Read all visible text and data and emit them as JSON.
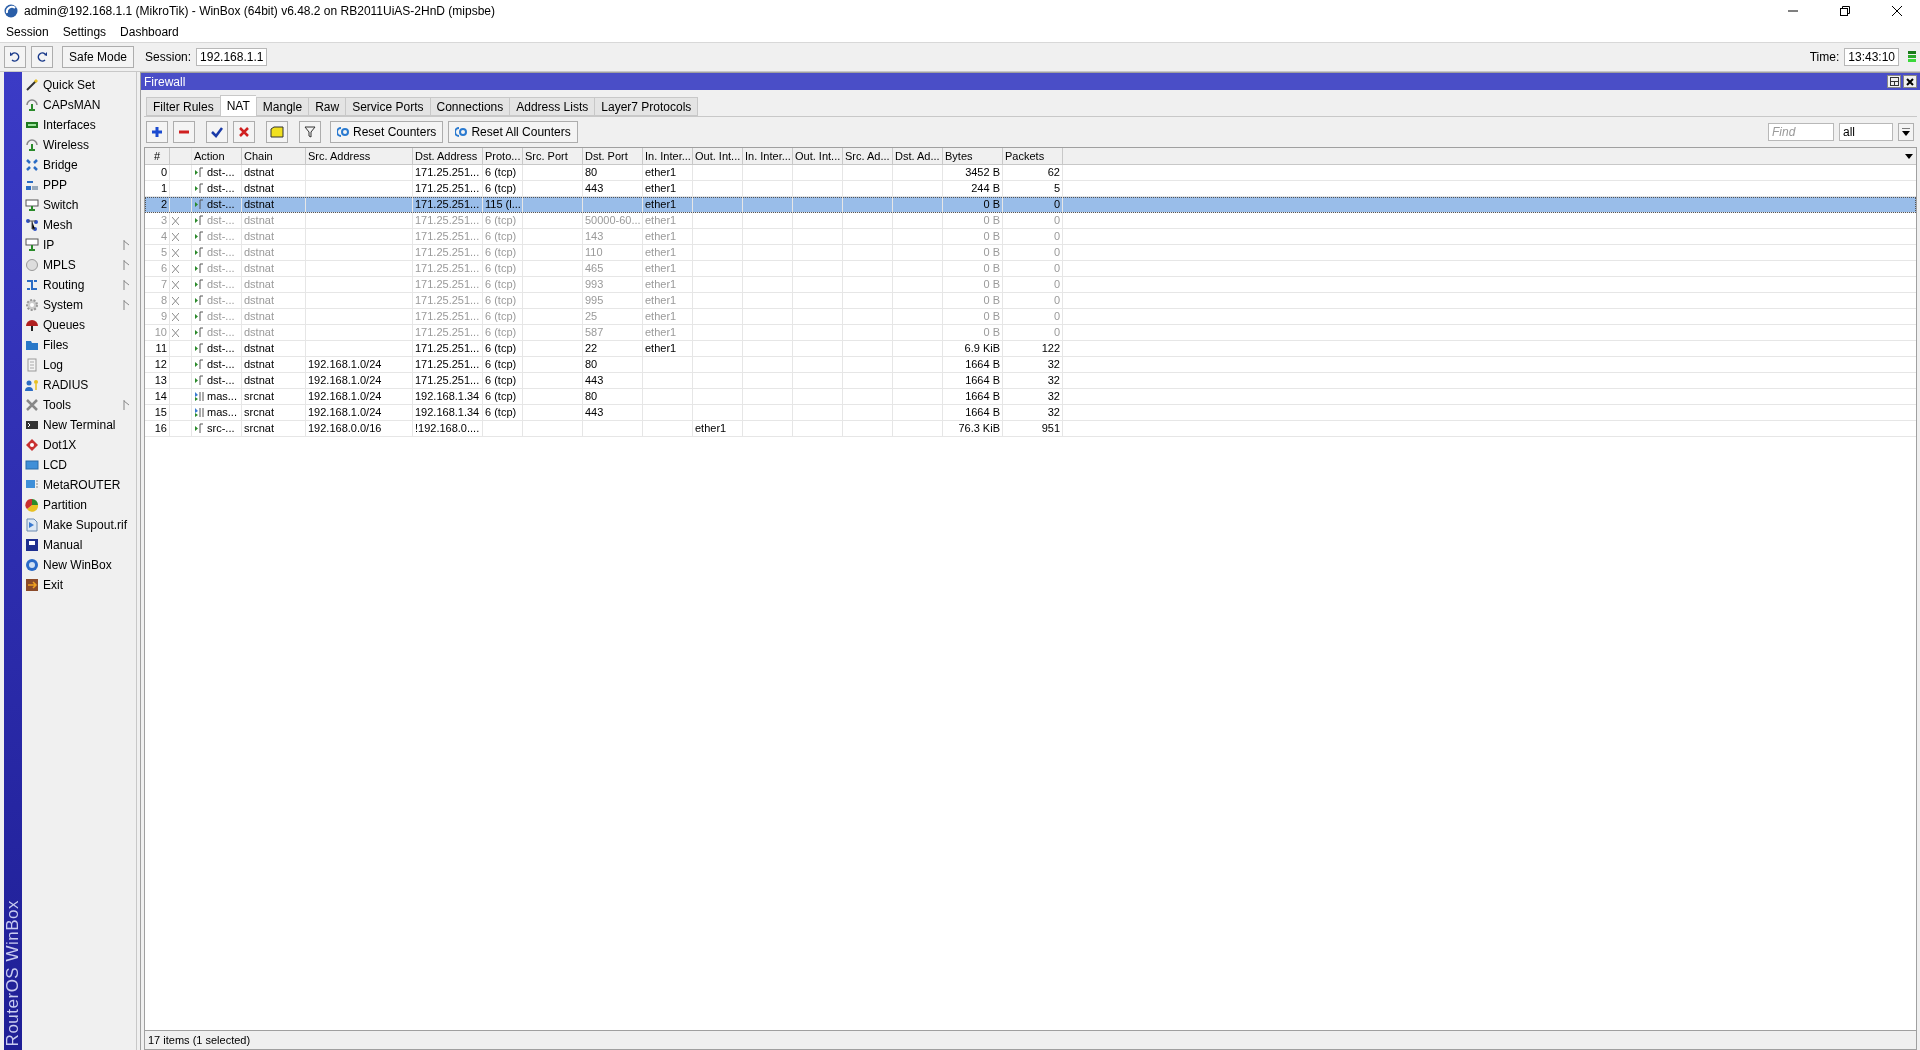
{
  "window": {
    "title": "admin@192.168.1.1 (MikroTik) - WinBox (64bit) v6.48.2 on RB2011UiAS-2HnD (mipsbe)"
  },
  "menu": [
    "Session",
    "Settings",
    "Dashboard"
  ],
  "toolbar": {
    "safe_mode": "Safe Mode",
    "session_label": "Session:",
    "session_value": "192.168.1.1",
    "time_label": "Time:",
    "time_value": "13:43:10"
  },
  "brand": "RouterOS WinBox",
  "sidebar": {
    "items": [
      {
        "label": "Quick Set",
        "submenu": false
      },
      {
        "label": "CAPsMAN",
        "submenu": false
      },
      {
        "label": "Interfaces",
        "submenu": false
      },
      {
        "label": "Wireless",
        "submenu": false
      },
      {
        "label": "Bridge",
        "submenu": false
      },
      {
        "label": "PPP",
        "submenu": false
      },
      {
        "label": "Switch",
        "submenu": false
      },
      {
        "label": "Mesh",
        "submenu": false
      },
      {
        "label": "IP",
        "submenu": true
      },
      {
        "label": "MPLS",
        "submenu": true
      },
      {
        "label": "Routing",
        "submenu": true
      },
      {
        "label": "System",
        "submenu": true
      },
      {
        "label": "Queues",
        "submenu": false
      },
      {
        "label": "Files",
        "submenu": false
      },
      {
        "label": "Log",
        "submenu": false
      },
      {
        "label": "RADIUS",
        "submenu": false
      },
      {
        "label": "Tools",
        "submenu": true
      },
      {
        "label": "New Terminal",
        "submenu": false
      },
      {
        "label": "Dot1X",
        "submenu": false
      },
      {
        "label": "LCD",
        "submenu": false
      },
      {
        "label": "MetaROUTER",
        "submenu": false
      },
      {
        "label": "Partition",
        "submenu": false
      },
      {
        "label": "Make Supout.rif",
        "submenu": false
      },
      {
        "label": "Manual",
        "submenu": false
      },
      {
        "label": "New WinBox",
        "submenu": false
      },
      {
        "label": "Exit",
        "submenu": false
      }
    ]
  },
  "firewall": {
    "title": "Firewall",
    "tabs": [
      {
        "label": "Filter Rules",
        "selected": false
      },
      {
        "label": "NAT",
        "selected": true
      },
      {
        "label": "Mangle",
        "selected": false
      },
      {
        "label": "Raw",
        "selected": false
      },
      {
        "label": "Service Ports",
        "selected": false
      },
      {
        "label": "Connections",
        "selected": false
      },
      {
        "label": "Address Lists",
        "selected": false
      },
      {
        "label": "Layer7 Protocols",
        "selected": false
      }
    ],
    "buttons": {
      "reset_counters": "Reset Counters",
      "reset_all_counters": "Reset All Counters"
    },
    "find": {
      "placeholder": "Find"
    },
    "filter_value": "all",
    "table": {
      "columns": [
        "#",
        "Action",
        "Chain",
        "Src. Address",
        "Dst. Address",
        "Proto...",
        "Src. Port",
        "Dst. Port",
        "In. Inter...",
        "Out. Int...",
        "In. Inter...",
        "Out. Int...",
        "Src. Ad...",
        "Dst. Ad...",
        "Bytes",
        "Packets"
      ],
      "rows": [
        {
          "number": "0",
          "kind": "nat",
          "disabled": false,
          "selected": false,
          "action": "dst-...",
          "chain": "dstnat",
          "dst_address": "171.25.251...",
          "protocol": "6 (tcp)",
          "dst_port": "80",
          "in_interface": "ether1",
          "bytes": "3452 B",
          "packets": "62"
        },
        {
          "number": "1",
          "kind": "nat",
          "disabled": false,
          "selected": false,
          "action": "dst-...",
          "chain": "dstnat",
          "dst_address": "171.25.251...",
          "protocol": "6 (tcp)",
          "dst_port": "443",
          "in_interface": "ether1",
          "bytes": "244 B",
          "packets": "5"
        },
        {
          "number": "2",
          "kind": "nat",
          "disabled": false,
          "selected": true,
          "action": "dst-...",
          "chain": "dstnat",
          "dst_address": "171.25.251...",
          "protocol": "115 (l...",
          "in_interface": "ether1",
          "bytes": "0 B",
          "packets": "0"
        },
        {
          "number": "3",
          "kind": "nat",
          "disabled": true,
          "selected": false,
          "action": "dst-...",
          "chain": "dstnat",
          "dst_address": "171.25.251...",
          "protocol": "6 (tcp)",
          "dst_port": "50000-60...",
          "in_interface": "ether1",
          "bytes": "0 B",
          "packets": "0"
        },
        {
          "number": "4",
          "kind": "nat",
          "disabled": true,
          "selected": false,
          "action": "dst-...",
          "chain": "dstnat",
          "dst_address": "171.25.251...",
          "protocol": "6 (tcp)",
          "dst_port": "143",
          "in_interface": "ether1",
          "bytes": "0 B",
          "packets": "0"
        },
        {
          "number": "5",
          "kind": "nat",
          "disabled": true,
          "selected": false,
          "action": "dst-...",
          "chain": "dstnat",
          "dst_address": "171.25.251...",
          "protocol": "6 (tcp)",
          "dst_port": "110",
          "in_interface": "ether1",
          "bytes": "0 B",
          "packets": "0"
        },
        {
          "number": "6",
          "kind": "nat",
          "disabled": true,
          "selected": false,
          "action": "dst-...",
          "chain": "dstnat",
          "dst_address": "171.25.251...",
          "protocol": "6 (tcp)",
          "dst_port": "465",
          "in_interface": "ether1",
          "bytes": "0 B",
          "packets": "0"
        },
        {
          "number": "7",
          "kind": "nat",
          "disabled": true,
          "selected": false,
          "action": "dst-...",
          "chain": "dstnat",
          "dst_address": "171.25.251...",
          "protocol": "6 (tcp)",
          "dst_port": "993",
          "in_interface": "ether1",
          "bytes": "0 B",
          "packets": "0"
        },
        {
          "number": "8",
          "kind": "nat",
          "disabled": true,
          "selected": false,
          "action": "dst-...",
          "chain": "dstnat",
          "dst_address": "171.25.251...",
          "protocol": "6 (tcp)",
          "dst_port": "995",
          "in_interface": "ether1",
          "bytes": "0 B",
          "packets": "0"
        },
        {
          "number": "9",
          "kind": "nat",
          "disabled": true,
          "selected": false,
          "action": "dst-...",
          "chain": "dstnat",
          "dst_address": "171.25.251...",
          "protocol": "6 (tcp)",
          "dst_port": "25",
          "in_interface": "ether1",
          "bytes": "0 B",
          "packets": "0"
        },
        {
          "number": "10",
          "kind": "nat",
          "disabled": true,
          "selected": false,
          "action": "dst-...",
          "chain": "dstnat",
          "dst_address": "171.25.251...",
          "protocol": "6 (tcp)",
          "dst_port": "587",
          "in_interface": "ether1",
          "bytes": "0 B",
          "packets": "0"
        },
        {
          "number": "11",
          "kind": "nat",
          "disabled": false,
          "selected": false,
          "action": "dst-...",
          "chain": "dstnat",
          "dst_address": "171.25.251...",
          "protocol": "6 (tcp)",
          "dst_port": "22",
          "in_interface": "ether1",
          "bytes": "6.9 KiB",
          "packets": "122"
        },
        {
          "number": "12",
          "kind": "nat",
          "disabled": false,
          "selected": false,
          "action": "dst-...",
          "chain": "dstnat",
          "src_address": "192.168.1.0/24",
          "dst_address": "171.25.251...",
          "protocol": "6 (tcp)",
          "dst_port": "80",
          "bytes": "1664 B",
          "packets": "32"
        },
        {
          "number": "13",
          "kind": "nat",
          "disabled": false,
          "selected": false,
          "action": "dst-...",
          "chain": "dstnat",
          "src_address": "192.168.1.0/24",
          "dst_address": "171.25.251...",
          "protocol": "6 (tcp)",
          "dst_port": "443",
          "bytes": "1664 B",
          "packets": "32"
        },
        {
          "number": "14",
          "kind": "masquerade",
          "disabled": false,
          "selected": false,
          "action": "mas...",
          "chain": "srcnat",
          "src_address": "192.168.1.0/24",
          "dst_address": "192.168.1.34",
          "protocol": "6 (tcp)",
          "dst_port": "80",
          "bytes": "1664 B",
          "packets": "32"
        },
        {
          "number": "15",
          "kind": "masquerade",
          "disabled": false,
          "selected": false,
          "action": "mas...",
          "chain": "srcnat",
          "src_address": "192.168.1.0/24",
          "dst_address": "192.168.1.34",
          "protocol": "6 (tcp)",
          "dst_port": "443",
          "bytes": "1664 B",
          "packets": "32"
        },
        {
          "number": "16",
          "kind": "nat",
          "disabled": false,
          "selected": false,
          "action": "src-...",
          "chain": "srcnat",
          "src_address": "192.168.0.0/16",
          "dst_address": "!192.168.0....",
          "out_interface": "ether1",
          "bytes": "76.3 KiB",
          "packets": "951"
        }
      ]
    },
    "status": "17 items (1 selected)"
  }
}
